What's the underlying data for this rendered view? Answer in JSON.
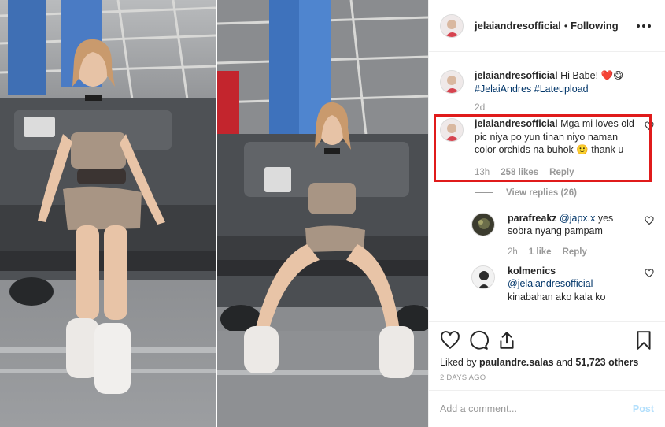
{
  "header": {
    "username": "jelaiandresofficial",
    "separator": "•",
    "follow_status": "Following",
    "more_icon": "more-horizontal-icon"
  },
  "caption": {
    "username": "jelaiandresofficial",
    "text": "Hi Babe! ❤️😋",
    "hashtags": "#JelaiAndres #Lateupload",
    "time": "2d"
  },
  "highlighted_comment": {
    "username": "jelaiandresofficial",
    "text": "Mga mi loves old pic niya po yun tinan niyo naman color orchids na buhok 🙂 thank u",
    "time": "13h",
    "likes": "258 likes",
    "reply_label": "Reply",
    "view_replies": "View replies (26)",
    "highlight_color": "#e01b1b"
  },
  "replies": [
    {
      "username": "parafreakz",
      "mention": "@japx.x",
      "text": "yes sobra nyang pampam",
      "time": "2h",
      "likes": "1 like",
      "reply_label": "Reply"
    },
    {
      "username": "kolmenics",
      "mention": "@jelaiandresofficial",
      "text": "kinabahan ako kala ko"
    }
  ],
  "actions": {
    "like_icon": "heart-icon",
    "comment_icon": "comment-icon",
    "share_icon": "share-icon",
    "save_icon": "bookmark-icon",
    "liked_by_prefix": "Liked by",
    "liked_by_user": "paulandre.salas",
    "liked_by_and": "and",
    "liked_by_count": "51,723 others",
    "timestamp": "2 DAYS AGO"
  },
  "add_comment": {
    "placeholder": "Add a comment...",
    "post_label": "Post"
  },
  "colors": {
    "link": "#003569",
    "muted": "#999999",
    "post_button": "#b2dffc"
  }
}
